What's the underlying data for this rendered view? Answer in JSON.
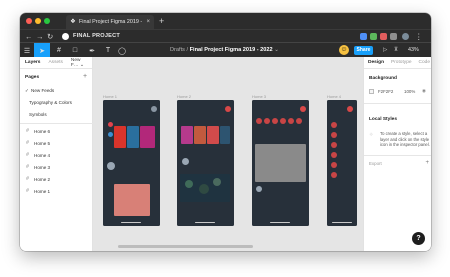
{
  "browser": {
    "tab_title": "Final Project Figma 2019 - 2022",
    "tab_close": "×",
    "new_tab": "+",
    "project_name": "FINAL PROJECT",
    "colors": {
      "close": "#fe5f57",
      "minimize": "#febc2e",
      "zoom": "#28c840",
      "chrome": "#2c2c2c"
    }
  },
  "toolbar": {
    "breadcrumb_root": "Drafts",
    "breadcrumb_sep": "/",
    "file_name": "Final Project Figma 2019 - 2022",
    "file_chevron": "⌄",
    "share_label": "Share",
    "zoom": "43%",
    "accent": "#18a0fb"
  },
  "left_panel": {
    "tabs": [
      "Layers",
      "Assets"
    ],
    "current_page_tab": "New F… ⌄",
    "pages_heading": "Pages",
    "pages_add": "+",
    "pages": [
      {
        "label": "New Feeds",
        "checked": true
      },
      {
        "label": "Typography & Colors",
        "checked": false
      },
      {
        "label": "Symbols",
        "checked": false
      }
    ],
    "layers": [
      "Home 6",
      "Home 5",
      "Home 4",
      "Home 3",
      "Home 2",
      "Home 1"
    ]
  },
  "canvas": {
    "frames": [
      "Home 1",
      "Home 2",
      "Home 3",
      "Home 4"
    ],
    "background": "#e5e5e5",
    "phone_color": "#27303a"
  },
  "right_panel": {
    "tabs": [
      "Design",
      "Prototype",
      "Code"
    ],
    "background_heading": "Background",
    "bg_hex": "F2F2F2",
    "bg_opacity": "100%",
    "local_styles_heading": "Local Styles",
    "local_styles_desc": "To create a style, select a layer and click on the style icon in the inspector panel.",
    "export_label": "Export",
    "export_add": "+"
  },
  "help_label": "?"
}
